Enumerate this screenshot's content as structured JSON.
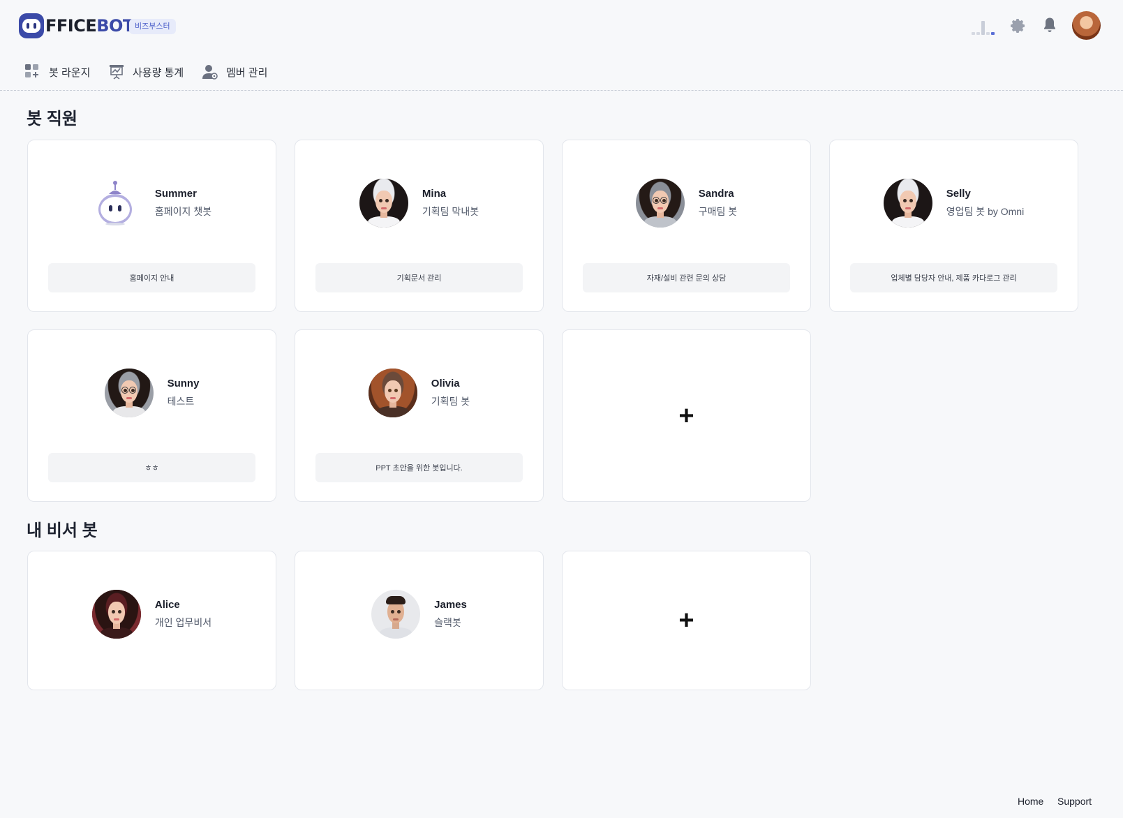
{
  "header": {
    "logo_text_prefix": "FFICE",
    "logo_text_suffix": "BOT",
    "plan_badge": "비즈부스터"
  },
  "nav": {
    "items": [
      {
        "label": "봇 라운지",
        "icon": "grid-plus-icon"
      },
      {
        "label": "사용량 통계",
        "icon": "presentation-chart-icon"
      },
      {
        "label": "멤버 관리",
        "icon": "user-gear-icon"
      }
    ]
  },
  "sections": {
    "bot_staff": {
      "title": "봇 직원",
      "cards": [
        {
          "name": "Summer",
          "role": "홈페이지 챗봇",
          "description": "홈페이지 안내"
        },
        {
          "name": "Mina",
          "role": "기획팀 막내봇",
          "description": "기획문서 관리"
        },
        {
          "name": "Sandra",
          "role": "구매팀 봇",
          "description": "자재/설비 관련 문의 상담"
        },
        {
          "name": "Selly",
          "role": "영업팀 봇 by Omni",
          "description": "업체별 담당자 안내, 제품 카다로그 관리"
        },
        {
          "name": "Sunny",
          "role": "테스트",
          "description": "ㅎㅎ"
        },
        {
          "name": "Olivia",
          "role": "기획팀 봇",
          "description": "PPT 초안을 위한 봇입니다."
        }
      ],
      "add_label": "+"
    },
    "my_assistant": {
      "title": "내 비서 봇",
      "cards": [
        {
          "name": "Alice",
          "role": "개인 업무비서"
        },
        {
          "name": "James",
          "role": "슬랙봇"
        }
      ],
      "add_label": "+"
    }
  },
  "footer": {
    "home": "Home",
    "support": "Support"
  },
  "colors": {
    "brand": "#3b4aa8",
    "background": "#f7f8fa",
    "badge_bg": "#e7ebfa",
    "badge_text": "#4a5ec9"
  }
}
